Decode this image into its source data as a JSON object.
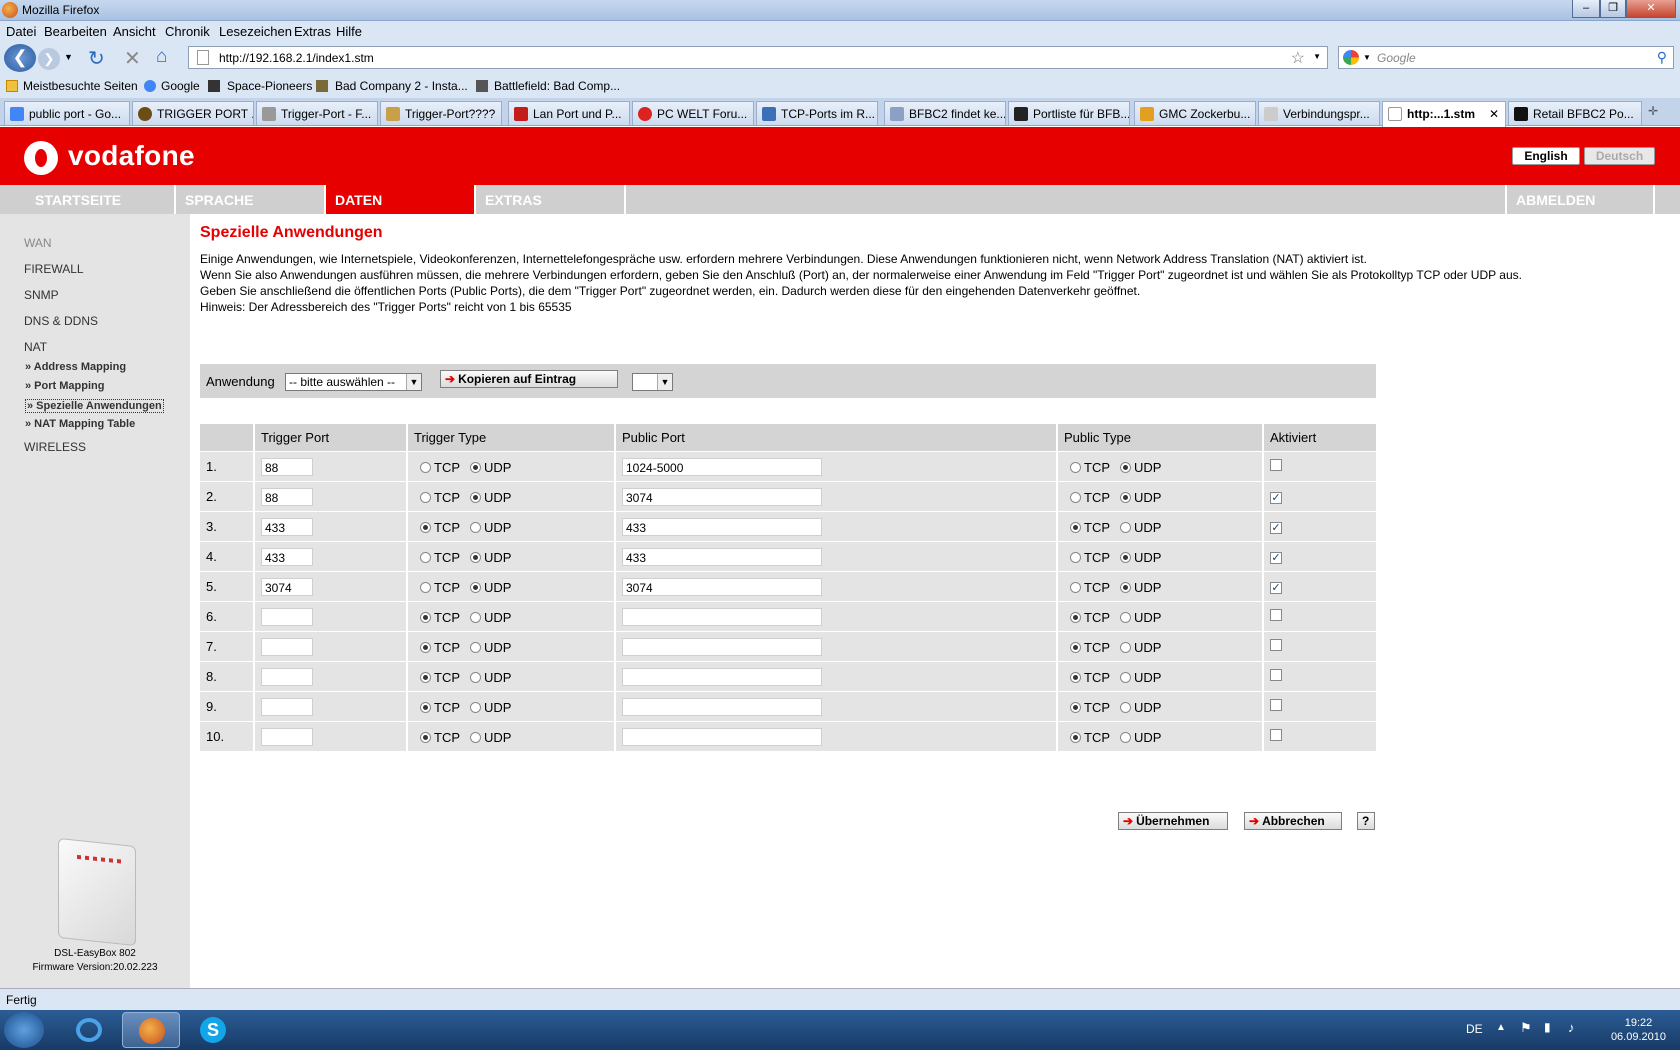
{
  "window": {
    "title": "Mozilla Firefox"
  },
  "menu": [
    "Datei",
    "Bearbeiten",
    "Ansicht",
    "Chronik",
    "Lesezeichen",
    "Extras",
    "Hilfe"
  ],
  "url": "http://192.168.2.1/index1.stm",
  "search_placeholder": "Google",
  "bookmarks": [
    "Meistbesuchte Seiten",
    "Google",
    "Space-Pioneers",
    "Bad Company 2 - Insta...",
    "Battlefield: Bad Comp..."
  ],
  "tabs": [
    "public port - Go...",
    "TRIGGER PORT ...",
    "Trigger-Port - F...",
    "Trigger-Port????",
    "Lan Port und P...",
    "PC WELT Foru...",
    "TCP-Ports im R...",
    "BFBC2 findet ke...",
    "Portliste für BFB...",
    "GMC Zockerbu...",
    "Verbindungspr...",
    "http:...1.stm",
    "Retail BFBC2 Po..."
  ],
  "vodafone": {
    "brand": "vodafone",
    "lang_en": "English",
    "lang_de": "Deutsch"
  },
  "nav": {
    "home": "STARTSEITE",
    "language": "SPRACHE",
    "data": "DATEN",
    "extras": "EXTRAS",
    "logout": "ABMELDEN"
  },
  "sidebar": {
    "wan": "WAN",
    "firewall": "FIREWALL",
    "snmp": "SNMP",
    "dns": "DNS & DDNS",
    "nat": "NAT",
    "address_mapping": "» Address Mapping",
    "port_mapping": "» Port Mapping",
    "special_apps": "» Spezielle Anwendungen",
    "nat_table": "» NAT Mapping Table",
    "wireless": "WIRELESS",
    "device": "DSL-EasyBox 802",
    "firmware": "Firmware Version:20.02.223"
  },
  "page": {
    "title": "Spezielle Anwendungen",
    "line1": "Einige Anwendungen, wie Internetspiele, Videokonferenzen, Internettelefongespräche usw. erfordern mehrere Verbindungen. Diese Anwendungen funktionieren nicht, wenn Network Address Translation (NAT) aktiviert ist.",
    "line2": "Wenn Sie also Anwendungen ausführen müssen, die mehrere Verbindungen erfordern, geben Sie den Anschluß (Port) an, der normalerweise einer Anwendung im Feld \"Trigger Port\" zugeordnet ist und wählen Sie als Protokolltyp TCP oder UDP aus.",
    "line3": "Geben Sie anschließend die öffentlichen Ports (Public Ports), die dem \"Trigger Port\" zugeordnet werden, ein. Dadurch werden diese für den eingehenden Datenverkehr geöffnet.",
    "line4": "Hinweis: Der Adressbereich des \"Trigger Ports\" reicht von 1 bis 65535",
    "app_label": "Anwendung",
    "app_select": "-- bitte auswählen --",
    "copy_btn": "Kopieren auf Eintrag",
    "apply_btn": "Übernehmen",
    "cancel_btn": "Abbrechen",
    "help_btn": "?"
  },
  "table": {
    "headers": [
      "Trigger Port",
      "Trigger Type",
      "Public Port",
      "Public Type",
      "Aktiviert"
    ],
    "tcp": "TCP",
    "udp": "UDP",
    "rows": [
      {
        "n": "1.",
        "trigger": "88",
        "ttype": "UDP",
        "public": "1024-5000",
        "ptype": "UDP",
        "active": false
      },
      {
        "n": "2.",
        "trigger": "88",
        "ttype": "UDP",
        "public": "3074",
        "ptype": "UDP",
        "active": true
      },
      {
        "n": "3.",
        "trigger": "433",
        "ttype": "TCP",
        "public": "433",
        "ptype": "TCP",
        "active": true
      },
      {
        "n": "4.",
        "trigger": "433",
        "ttype": "UDP",
        "public": "433",
        "ptype": "UDP",
        "active": true
      },
      {
        "n": "5.",
        "trigger": "3074",
        "ttype": "UDP",
        "public": "3074",
        "ptype": "UDP",
        "active": true
      },
      {
        "n": "6.",
        "trigger": "",
        "ttype": "TCP",
        "public": "",
        "ptype": "TCP",
        "active": false
      },
      {
        "n": "7.",
        "trigger": "",
        "ttype": "TCP",
        "public": "",
        "ptype": "TCP",
        "active": false
      },
      {
        "n": "8.",
        "trigger": "",
        "ttype": "TCP",
        "public": "",
        "ptype": "TCP",
        "active": false
      },
      {
        "n": "9.",
        "trigger": "",
        "ttype": "TCP",
        "public": "",
        "ptype": "TCP",
        "active": false
      },
      {
        "n": "10.",
        "trigger": "",
        "ttype": "TCP",
        "public": "",
        "ptype": "TCP",
        "active": false
      }
    ]
  },
  "status": "Fertig",
  "taskbar": {
    "lang": "DE",
    "time": "19:22",
    "date": "06.09.2010"
  },
  "colors": {
    "vodafone_red": "#e60000",
    "nav_gray": "#cfcfcf"
  }
}
